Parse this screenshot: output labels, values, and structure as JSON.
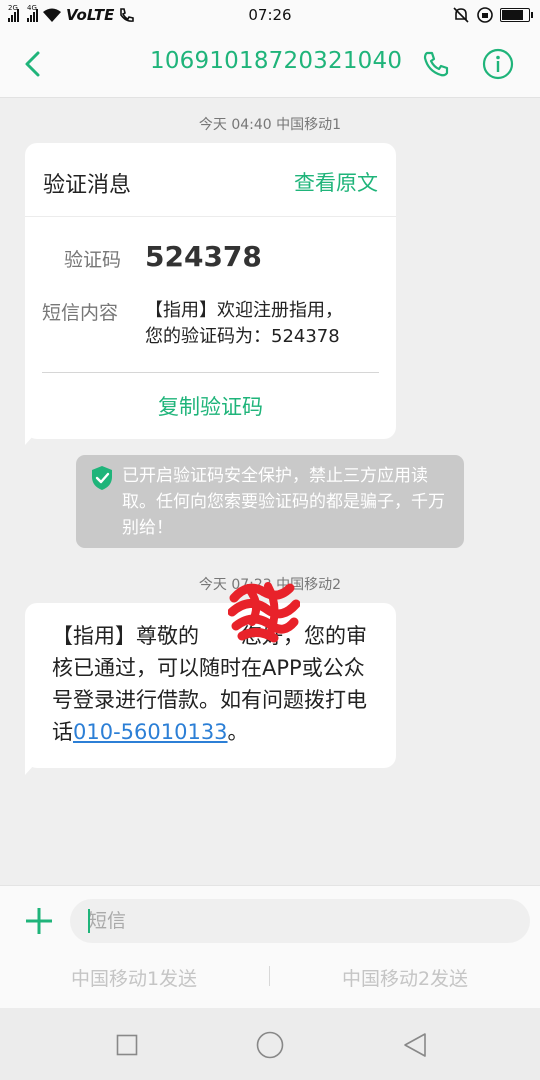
{
  "status_bar": {
    "time": "07:26",
    "network_1": "2G",
    "network_2": "4G",
    "volte": "VoLTE",
    "battery_level": 0.85
  },
  "header": {
    "title": "10691018720321040",
    "accent_color": "#1fb47a"
  },
  "messages": {
    "msg1_time": "今天 04:40  中国移动1",
    "card": {
      "title": "验证消息",
      "view_original": "查看原文",
      "code_label": "验证码",
      "code_value": "524378",
      "content_label": "短信内容",
      "content_line1": "【指用】欢迎注册指用，",
      "content_line2": "您的验证码为：524378",
      "copy_label": "复制验证码"
    },
    "notice_text": "已开启验证码安全保护，禁止三方应用读取。任何向您索要验证码的都是骗子，千万别给！",
    "msg2_time": "今天 07:23  中国移动2",
    "msg2_text_before": "【指用】尊敬的",
    "msg2_text_hidden": "用户",
    "msg2_text_middle": "您好，您的审核已通过，可以随时在APP或公众号登录进行借款。如有问题拨打电话",
    "msg2_phone": "010-56010133",
    "msg2_text_after": "。"
  },
  "compose": {
    "placeholder": "短信",
    "send_sim1": "中国移动1发送",
    "send_sim2": "中国移动2发送"
  },
  "icons": {
    "back": "chevron-left-icon",
    "call": "phone-icon",
    "info": "info-icon",
    "shield": "shield-check-icon",
    "add": "plus-icon",
    "recents": "square-icon",
    "home": "circle-icon",
    "nav_back": "triangle-left-icon"
  }
}
